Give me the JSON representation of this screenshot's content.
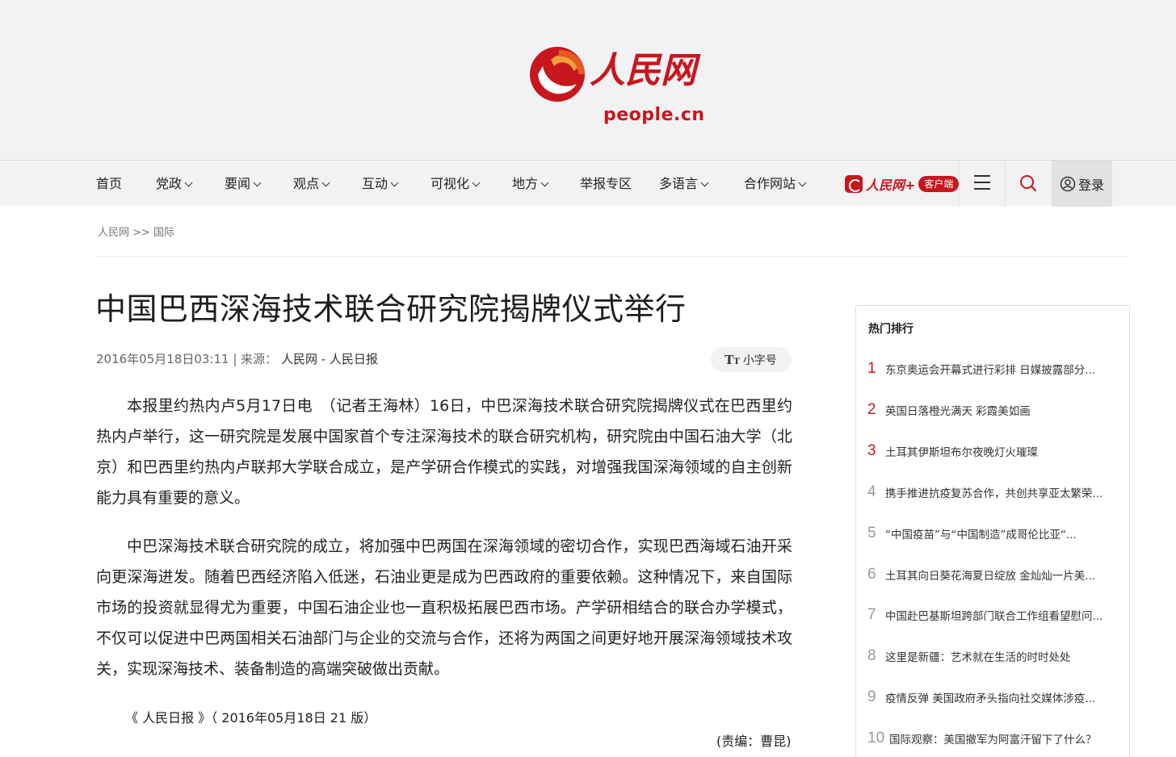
{
  "site": {
    "logo_cn": "人民网",
    "logo_domain": "people.cn",
    "brand_color": "#c8161d"
  },
  "nav": {
    "items": [
      {
        "label": "首页",
        "dropdown": false
      },
      {
        "label": "党政",
        "dropdown": true
      },
      {
        "label": "要闻",
        "dropdown": true
      },
      {
        "label": "观点",
        "dropdown": true
      },
      {
        "label": "互动",
        "dropdown": true
      },
      {
        "label": "可视化",
        "dropdown": true
      },
      {
        "label": "地方",
        "dropdown": true
      },
      {
        "label": "举报专区",
        "dropdown": false
      },
      {
        "label": "多语言",
        "dropdown": true
      },
      {
        "label": "合作网站",
        "dropdown": true
      }
    ],
    "app_name": "人民网+",
    "app_badge": "客户端",
    "menu_icon": "hamburger-icon",
    "search_icon": "search-icon",
    "login_label": "登录"
  },
  "breadcrumb": "人民网 >> 国际",
  "article": {
    "title": "中国巴西深海技术联合研究院揭牌仪式举行",
    "date": "2016年05月18日03:11",
    "source_prefix": "| 来源：",
    "source": "人民网 - 人民日报",
    "font_toggle": "小字号",
    "paragraphs": [
      "本报里约热内卢5月17日电　（记者王海林）16日，中巴深海技术联合研究院揭牌仪式在巴西里约热内卢举行，这一研究院是发展中国家首个专注深海技术的联合研究机构，研究院由中国石油大学（北京）和巴西里约热内卢联邦大学联合成立，是产学研合作模式的实践，对增强我国深海领域的自主创新能力具有重要的意义。",
      "中巴深海技术联合研究院的成立，将加强中巴两国在深海领域的密切合作，实现巴西海域石油开采向更深海进发。随着巴西经济陷入低迷，石油业更是成为巴西政府的重要依赖。这种情况下，来自国际市场的投资就显得尤为重要，中国石油企业也一直积极拓展巴西市场。产学研相结合的联合办学模式，不仅可以促进中巴两国相关石油部门与企业的交流与合作，还将为两国之间更好地开展深海领域技术攻关，实现深海技术、装备制造的高端突破做出贡献。"
    ],
    "source_line": "《 人民日报 》（ 2016年05月18日 21 版）",
    "editor": "(责编：曹昆)"
  },
  "sidebar": {
    "title": "热门排行",
    "items": [
      {
        "rank": "1",
        "text": "东京奥运会开幕式进行彩排 日媒披露部分..."
      },
      {
        "rank": "2",
        "text": "英国日落橙光满天 彩霞美如画"
      },
      {
        "rank": "3",
        "text": "土耳其伊斯坦布尔夜晚灯火璀璨"
      },
      {
        "rank": "4",
        "text": "携手推进抗疫复苏合作，共创共享亚太繁荣..."
      },
      {
        "rank": "5",
        "text": "“中国疫苗”与“中国制造”成哥伦比亚“..."
      },
      {
        "rank": "6",
        "text": "土耳其向日葵花海夏日绽放 金灿灿一片美..."
      },
      {
        "rank": "7",
        "text": "中国赴巴基斯坦跨部门联合工作组看望慰问..."
      },
      {
        "rank": "8",
        "text": "这里是新疆：艺术就在生活的时时处处"
      },
      {
        "rank": "9",
        "text": "疫情反弹 美国政府矛头指向社交媒体涉疫..."
      },
      {
        "rank": "10",
        "text": "国际观察：美国撤军为阿富汗留下了什么？"
      }
    ]
  }
}
